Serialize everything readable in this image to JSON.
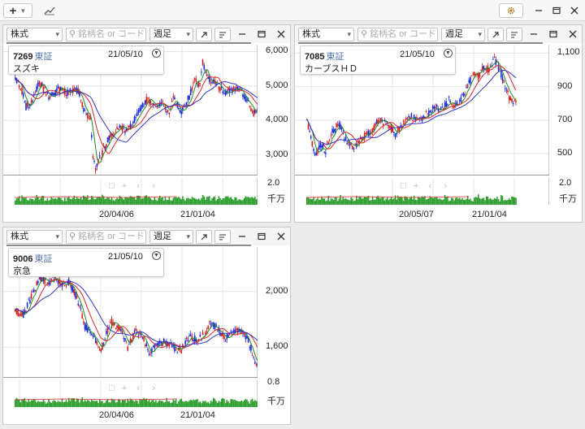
{
  "toolbar": {
    "add_label": "+",
    "dropdown_icon": "chevron-down-icon",
    "chart_icon": "trend-line-icon",
    "settings_icon": "gear-icon"
  },
  "colors": {
    "up": "#d42020",
    "down": "#1a2bd8",
    "ma_short": "#1f8a1f",
    "ma_mid": "#d52a2a",
    "ma_long": "#3434c8",
    "volume": "#2e9e2e",
    "grid": "#e4e4e4"
  },
  "panels": [
    {
      "market_select": "株式",
      "search_placeholder": "銘柄名 or コード",
      "period_select": "週足",
      "card": {
        "code": "7269",
        "market": "東証",
        "date": "21/05/10",
        "name": "スズキ"
      },
      "price_ticks": [
        "6,000",
        "5,000",
        "4,000",
        "3,000"
      ],
      "volume_tick": "2.0",
      "volume_unit": "千万",
      "date_ticks": [
        "20/04/06",
        "21/01/04"
      ],
      "chart_data": {
        "type": "candlestick",
        "ylim": [
          2400,
          6200
        ],
        "ticks": [
          6000,
          5000,
          4000,
          3000
        ],
        "anchors": [
          [
            0,
            5200
          ],
          [
            4,
            5000
          ],
          [
            8,
            4400
          ],
          [
            12,
            4500
          ],
          [
            18,
            5100
          ],
          [
            25,
            4700
          ],
          [
            32,
            4900
          ],
          [
            38,
            4800
          ],
          [
            44,
            4900
          ],
          [
            48,
            4800
          ],
          [
            52,
            4200
          ],
          [
            56,
            4100
          ],
          [
            58,
            3000
          ],
          [
            60,
            2600
          ],
          [
            64,
            3000
          ],
          [
            70,
            3500
          ],
          [
            78,
            3800
          ],
          [
            84,
            3700
          ],
          [
            92,
            4200
          ],
          [
            98,
            4600
          ],
          [
            104,
            4400
          ],
          [
            110,
            4500
          ],
          [
            114,
            4200
          ],
          [
            116,
            4300
          ],
          [
            118,
            4700
          ],
          [
            124,
            4200
          ],
          [
            130,
            4700
          ],
          [
            134,
            5200
          ],
          [
            138,
            5000
          ],
          [
            140,
            5700
          ],
          [
            144,
            5200
          ],
          [
            150,
            5100
          ],
          [
            156,
            4800
          ],
          [
            162,
            4900
          ],
          [
            168,
            4900
          ],
          [
            174,
            4500
          ],
          [
            178,
            4200
          ],
          [
            182,
            4300
          ]
        ]
      }
    },
    {
      "market_select": "株式",
      "search_placeholder": "銘柄名 or コード",
      "period_select": "週足",
      "card": {
        "code": "7085",
        "market": "東証",
        "date": "21/05/10",
        "name": "カーブスＨＤ"
      },
      "price_ticks": [
        "1,100",
        "900",
        "700",
        "500"
      ],
      "volume_tick": "2.0",
      "volume_unit": "千万",
      "date_ticks": [
        "20/05/07",
        "21/01/04"
      ],
      "chart_data": {
        "type": "candlestick",
        "ylim": [
          370,
          1150
        ],
        "ticks": [
          1100,
          900,
          700,
          500
        ],
        "anchors": [
          [
            0,
            700
          ],
          [
            2,
            640
          ],
          [
            6,
            480
          ],
          [
            10,
            560
          ],
          [
            14,
            520
          ],
          [
            18,
            620
          ],
          [
            24,
            680
          ],
          [
            30,
            560
          ],
          [
            36,
            540
          ],
          [
            42,
            600
          ],
          [
            48,
            640
          ],
          [
            54,
            700
          ],
          [
            60,
            680
          ],
          [
            66,
            620
          ],
          [
            72,
            680
          ],
          [
            78,
            720
          ],
          [
            84,
            700
          ],
          [
            90,
            740
          ],
          [
            96,
            780
          ],
          [
            100,
            760
          ],
          [
            106,
            820
          ],
          [
            110,
            780
          ],
          [
            116,
            840
          ],
          [
            120,
            900
          ],
          [
            124,
            980
          ],
          [
            128,
            960
          ],
          [
            132,
            1020
          ],
          [
            136,
            1000
          ],
          [
            140,
            1060
          ],
          [
            144,
            1000
          ],
          [
            148,
            900
          ],
          [
            152,
            820
          ],
          [
            156,
            810
          ]
        ]
      }
    },
    {
      "market_select": "株式",
      "search_placeholder": "銘柄名 or コード",
      "period_select": "週足",
      "card": {
        "code": "9006",
        "market": "東証",
        "date": "21/05/10",
        "name": "京急"
      },
      "price_ticks": [
        "2,000",
        "1,600"
      ],
      "volume_tick": "0.8",
      "volume_unit": "千万",
      "date_ticks": [
        "20/04/06",
        "21/01/04"
      ],
      "chart_data": {
        "type": "candlestick",
        "ylim": [
          1380,
          2320
        ],
        "ticks": [
          2000,
          1600
        ],
        "anchors": [
          [
            0,
            1860
          ],
          [
            6,
            1830
          ],
          [
            12,
            1960
          ],
          [
            18,
            2100
          ],
          [
            24,
            2060
          ],
          [
            30,
            2100
          ],
          [
            36,
            2040
          ],
          [
            40,
            2070
          ],
          [
            44,
            2000
          ],
          [
            48,
            1900
          ],
          [
            52,
            1750
          ],
          [
            56,
            1720
          ],
          [
            60,
            1640
          ],
          [
            64,
            1580
          ],
          [
            68,
            1700
          ],
          [
            72,
            1780
          ],
          [
            78,
            1740
          ],
          [
            84,
            1600
          ],
          [
            90,
            1720
          ],
          [
            96,
            1660
          ],
          [
            100,
            1560
          ],
          [
            106,
            1620
          ],
          [
            112,
            1640
          ],
          [
            118,
            1600
          ],
          [
            124,
            1580
          ],
          [
            130,
            1680
          ],
          [
            136,
            1650
          ],
          [
            142,
            1700
          ],
          [
            146,
            1780
          ],
          [
            152,
            1720
          ],
          [
            156,
            1660
          ],
          [
            162,
            1700
          ],
          [
            168,
            1720
          ],
          [
            174,
            1660
          ],
          [
            178,
            1520
          ],
          [
            180,
            1470
          ],
          [
            184,
            1500
          ]
        ]
      }
    }
  ]
}
